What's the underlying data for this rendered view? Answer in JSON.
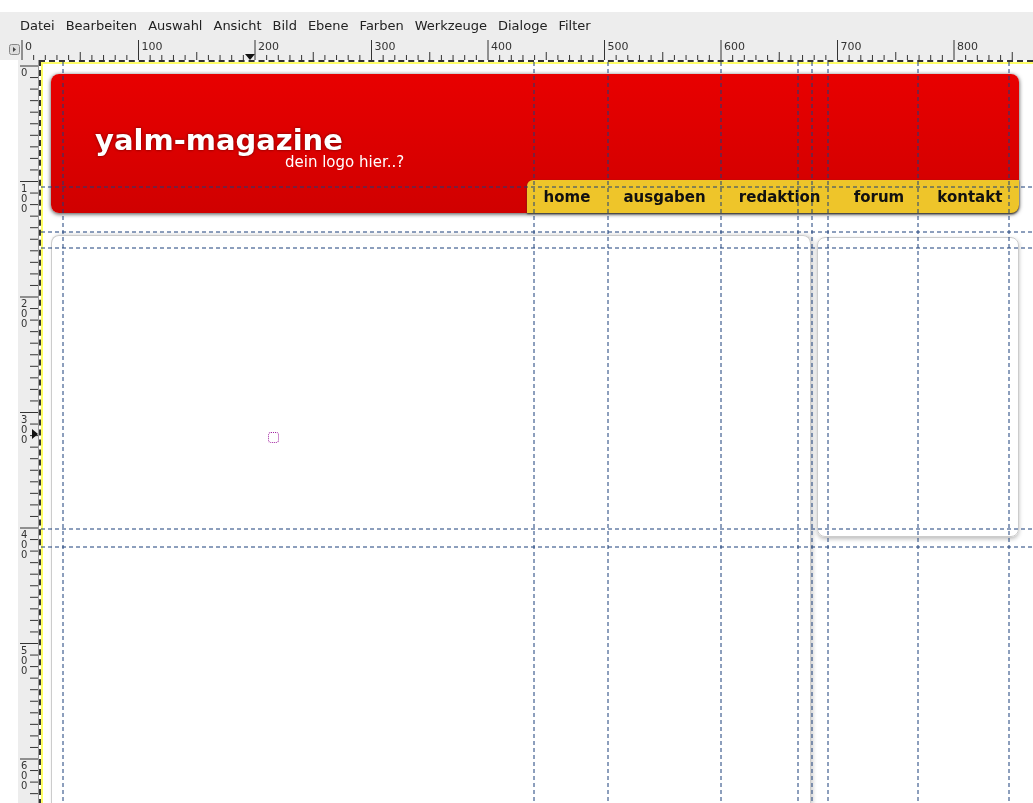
{
  "menu_bar": [
    {
      "label": "Datei"
    },
    {
      "label": "Bearbeiten"
    },
    {
      "label": "Auswahl"
    },
    {
      "label": "Ansicht"
    },
    {
      "label": "Bild"
    },
    {
      "label": "Ebene"
    },
    {
      "label": "Farben"
    },
    {
      "label": "Werkzeuge"
    },
    {
      "label": "Dialoge"
    },
    {
      "label": "Filter"
    }
  ],
  "horizontal_ruler": [
    "0",
    "100",
    "200",
    "300",
    "400",
    "500",
    "600",
    "700",
    "800"
  ],
  "vertical_ruler": [
    "0",
    "100",
    "200",
    "300",
    "400",
    "500",
    "600"
  ],
  "canvas": {
    "header": {
      "logo": "yalm-magazine",
      "tagline": "dein logo hier..?",
      "nav": [
        {
          "label": "home"
        },
        {
          "label": "ausgaben"
        },
        {
          "label": "redaktion"
        },
        {
          "label": "forum"
        },
        {
          "label": "kontakt"
        }
      ]
    }
  }
}
